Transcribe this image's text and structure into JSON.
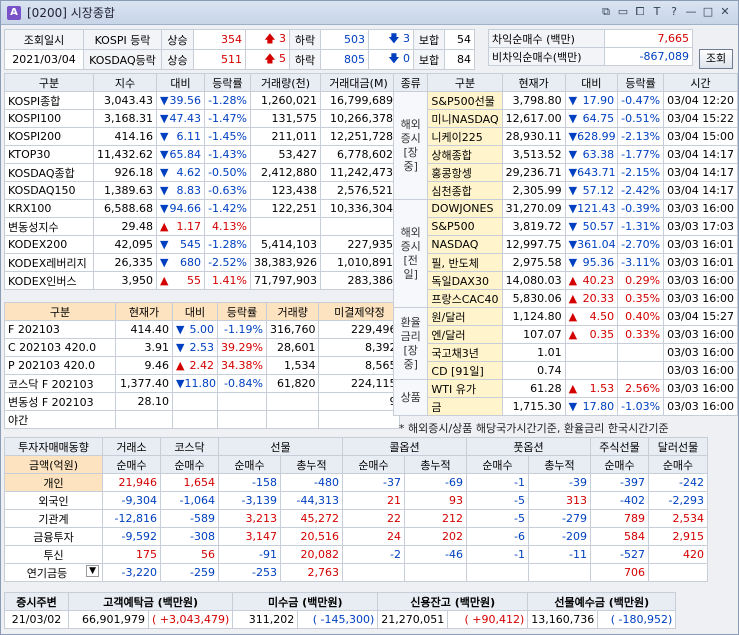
{
  "window": {
    "code": "[0200]",
    "title": "시장종합",
    "icon_letter": "A"
  },
  "header": {
    "date_label": "조회일시",
    "date": "2021/03/04",
    "kospi_label": "KOSPI 등락",
    "kosdaq_label": "KOSDAQ등락",
    "up_label": "상승",
    "down_label": "하락",
    "flat_label": "보합",
    "kospi": {
      "up": "354",
      "up_limit": "3",
      "down": "503",
      "down_limit": "3",
      "flat": "54"
    },
    "kosdaq": {
      "up": "511",
      "up_limit": "5",
      "down": "805",
      "down_limit": "0",
      "flat": "84"
    },
    "arb_buy_label": "차익순매수 (백만)",
    "arb_buy": "7,665",
    "nonarb_buy_label": "비차익순매수(백만)",
    "nonarb_buy": "-867,089",
    "inquiry_button": "조회"
  },
  "index_table": {
    "headers": [
      "구분",
      "지수",
      "대비",
      "등락률",
      "거래량(천)",
      "거래대금(M)"
    ],
    "rows": [
      {
        "name": "KOSPI종합",
        "value": "3,043.43",
        "dir": "down",
        "chg": "39.56",
        "rate": "-1.28%",
        "vol": "1,260,021",
        "amt": "16,799,689"
      },
      {
        "name": "KOSPI100",
        "value": "3,168.31",
        "dir": "down",
        "chg": "47.43",
        "rate": "-1.47%",
        "vol": "131,575",
        "amt": "10,266,378"
      },
      {
        "name": "KOSPI200",
        "value": "414.16",
        "dir": "down",
        "chg": "6.11",
        "rate": "-1.45%",
        "vol": "211,011",
        "amt": "12,251,728"
      },
      {
        "name": "KTOP30",
        "value": "11,432.62",
        "dir": "down",
        "chg": "65.84",
        "rate": "-1.43%",
        "vol": "53,427",
        "amt": "6,778,602"
      },
      {
        "name": "KOSDAQ종합",
        "value": "926.18",
        "dir": "down",
        "chg": "4.62",
        "rate": "-0.50%",
        "vol": "2,412,880",
        "amt": "11,242,473"
      },
      {
        "name": "KOSDAQ150",
        "value": "1,389.63",
        "dir": "down",
        "chg": "8.83",
        "rate": "-0.63%",
        "vol": "123,438",
        "amt": "2,576,521"
      },
      {
        "name": "KRX100",
        "value": "6,588.68",
        "dir": "down",
        "chg": "94.66",
        "rate": "-1.42%",
        "vol": "122,251",
        "amt": "10,336,304"
      },
      {
        "name": "변동성지수",
        "value": "29.48",
        "dir": "up",
        "chg": "1.17",
        "rate": "4.13%",
        "vol": "",
        "amt": ""
      },
      {
        "name": "KODEX200",
        "value": "42,095",
        "dir": "down",
        "chg": "545",
        "rate": "-1.28%",
        "vol": "5,414,103",
        "amt": "227,935"
      },
      {
        "name": "KODEX레버리지",
        "value": "26,335",
        "dir": "down",
        "chg": "680",
        "rate": "-2.52%",
        "vol": "38,383,926",
        "amt": "1,010,891"
      },
      {
        "name": "KODEX인버스",
        "value": "3,950",
        "dir": "up",
        "chg": "55",
        "rate": "1.41%",
        "vol": "71,797,903",
        "amt": "283,386"
      }
    ]
  },
  "deriv_table": {
    "headers": [
      "구분",
      "현재가",
      "대비",
      "등락률",
      "거래량",
      "미결제약정"
    ],
    "rows": [
      {
        "name": "F 202103",
        "value": "414.40",
        "dir": "down",
        "chg": "5.00",
        "rate": "-1.19%",
        "vol": "316,760",
        "oi": "229,496"
      },
      {
        "name": "C 202103 420.0",
        "value": "3.91",
        "dir": "down",
        "chg": "2.53",
        "rate": "39.29%",
        "vol": "28,601",
        "oi": "8,392"
      },
      {
        "name": "P 202103 420.0",
        "value": "9.46",
        "dir": "up",
        "chg": "2.42",
        "rate": "34.38%",
        "vol": "1,534",
        "oi": "8,565"
      },
      {
        "name": "코스닥 F 202103",
        "value": "1,377.40",
        "dir": "down",
        "chg": "11.80",
        "rate": "-0.84%",
        "vol": "61,820",
        "oi": "224,115"
      },
      {
        "name": "변동성 F 202103",
        "value": "28.10",
        "dir": "",
        "chg": "",
        "rate": "",
        "vol": "",
        "oi": "9"
      },
      {
        "name": "야간",
        "value": "",
        "dir": "",
        "chg": "",
        "rate": "",
        "vol": "",
        "oi": ""
      }
    ]
  },
  "world_table": {
    "headers": [
      "종류",
      "구분",
      "현재가",
      "대비",
      "등락률",
      "시간"
    ],
    "groups": [
      {
        "label": "해외\n증시\n[장중]",
        "rows": [
          {
            "name": "S&P500선물",
            "value": "3,798.80",
            "dir": "down",
            "chg": "17.90",
            "rate": "-0.47%",
            "time": "03/04 12:20"
          },
          {
            "name": "미니NASDAQ",
            "value": "12,617.00",
            "dir": "down",
            "chg": "64.75",
            "rate": "-0.51%",
            "time": "03/04 15:22"
          },
          {
            "name": "니케이225",
            "value": "28,930.11",
            "dir": "down",
            "chg": "628.99",
            "rate": "-2.13%",
            "time": "03/04 15:00"
          },
          {
            "name": "상해종합",
            "value": "3,513.52",
            "dir": "down",
            "chg": "63.38",
            "rate": "-1.77%",
            "time": "03/04 14:17"
          },
          {
            "name": "홍콩항셍",
            "value": "29,236.71",
            "dir": "down",
            "chg": "643.71",
            "rate": "-2.15%",
            "time": "03/04 14:17"
          },
          {
            "name": "심천종합",
            "value": "2,305.99",
            "dir": "down",
            "chg": "57.12",
            "rate": "-2.42%",
            "time": "03/04 14:17"
          }
        ]
      },
      {
        "label": "해외\n증시\n[전일]",
        "rows": [
          {
            "name": "DOWJONES",
            "value": "31,270.09",
            "dir": "down",
            "chg": "121.43",
            "rate": "-0.39%",
            "time": "03/03 16:00"
          },
          {
            "name": "S&P500",
            "value": "3,819.72",
            "dir": "down",
            "chg": "50.57",
            "rate": "-1.31%",
            "time": "03/03 17:03"
          },
          {
            "name": "NASDAQ",
            "value": "12,997.75",
            "dir": "down",
            "chg": "361.04",
            "rate": "-2.70%",
            "time": "03/03 16:01"
          },
          {
            "name": "필, 반도체",
            "value": "2,975.58",
            "dir": "down",
            "chg": "95.36",
            "rate": "-3.11%",
            "time": "03/03 16:01"
          },
          {
            "name": "독일DAX30",
            "value": "14,080.03",
            "dir": "up",
            "chg": "40.23",
            "rate": "0.29%",
            "time": "03/03 16:00"
          },
          {
            "name": "프랑스CAC40",
            "value": "5,830.06",
            "dir": "up",
            "chg": "20.33",
            "rate": "0.35%",
            "time": "03/03 16:00"
          }
        ]
      },
      {
        "label": "환율\n금리\n[장중]",
        "rows": [
          {
            "name": "원/달러",
            "value": "1,124.80",
            "dir": "up",
            "chg": "4.50",
            "rate": "0.40%",
            "time": "03/04 15:27"
          },
          {
            "name": "엔/달러",
            "value": "107.07",
            "dir": "up",
            "chg": "0.35",
            "rate": "0.33%",
            "time": "03/03 16:00"
          },
          {
            "name": "국고채3년",
            "value": "1.01",
            "dir": "",
            "chg": "",
            "rate": "",
            "time": "03/03 16:00"
          },
          {
            "name": "CD [91일]",
            "value": "0.74",
            "dir": "",
            "chg": "",
            "rate": "",
            "time": "03/03 16:00"
          }
        ]
      },
      {
        "label": "상품",
        "rows": [
          {
            "name": "WTI 유가",
            "value": "61.28",
            "dir": "up",
            "chg": "1.53",
            "rate": "2.56%",
            "time": "03/03 16:00"
          },
          {
            "name": "금",
            "value": "1,715.30",
            "dir": "down",
            "chg": "17.80",
            "rate": "-1.03%",
            "time": "03/03 16:00"
          }
        ]
      }
    ],
    "note": "* 해외증시/상품 해당국가시간기준, 환율금리 한국시간기준"
  },
  "investor_table": {
    "title": "투자자매매동향",
    "unit": "금액(억원)",
    "group_headers": [
      "거래소",
      "코스닥",
      "선물",
      "콜옵션",
      "풋옵션",
      "주식선물",
      "달러선물"
    ],
    "sub_net": "순매수",
    "sub_cum": "총누적",
    "rows": [
      {
        "name": "개인",
        "vals": [
          "21,946",
          "1,654",
          "-158",
          "-480",
          "-37",
          "-69",
          "-1",
          "-39",
          "-397",
          "-242"
        ]
      },
      {
        "name": "외국인",
        "vals": [
          "-9,304",
          "-1,064",
          "-3,139",
          "-44,313",
          "21",
          "93",
          "-5",
          "313",
          "-402",
          "-2,293"
        ]
      },
      {
        "name": "기관계",
        "vals": [
          "-12,816",
          "-589",
          "3,213",
          "45,272",
          "22",
          "212",
          "-5",
          "-279",
          "789",
          "2,534"
        ]
      },
      {
        "name": "금융투자",
        "vals": [
          "-9,592",
          "-308",
          "3,147",
          "20,516",
          "24",
          "202",
          "-6",
          "-209",
          "584",
          "2,915"
        ]
      },
      {
        "name": "투신",
        "vals": [
          "175",
          "56",
          "-91",
          "20,082",
          "-2",
          "-46",
          "-1",
          "-11",
          "-527",
          "420"
        ]
      },
      {
        "name": "연기금등",
        "vals": [
          "-3,220",
          "-259",
          "-253",
          "2,763",
          "",
          "",
          "",
          "",
          "706",
          ""
        ]
      }
    ]
  },
  "footer": {
    "headers": [
      "증시주변",
      "고객예탁금 (백만원)",
      "미수금 (백만원)",
      "신용잔고 (백만원)",
      "선물예수금 (백만원)"
    ],
    "date": "21/03/02",
    "deposit": "66,901,979",
    "deposit_chg": "+3,043,479",
    "unpaid": "311,202",
    "unpaid_chg": "-145,300",
    "credit": "21,270,051",
    "credit_chg": "+90,412",
    "fut_dep": "13,160,736",
    "fut_dep_chg": "-180,952"
  }
}
